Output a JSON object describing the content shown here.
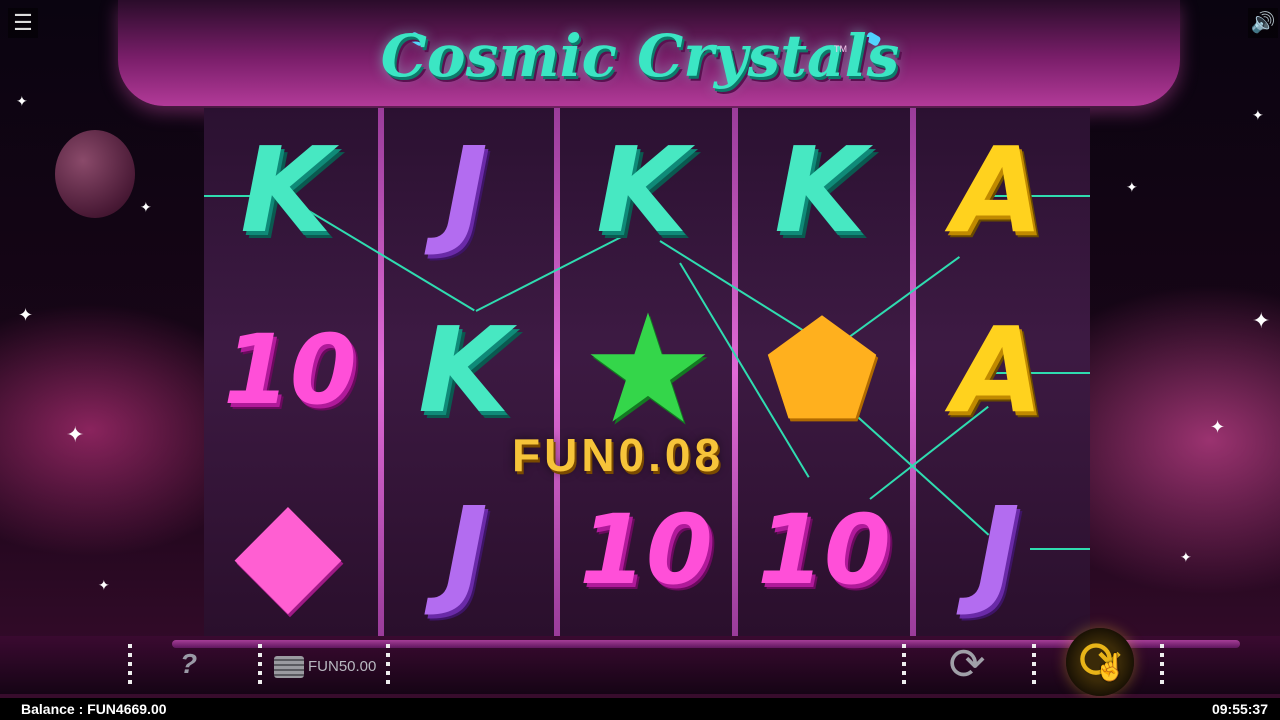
{
  "game": {
    "title": "Cosmic Crystals",
    "trademark": "TM"
  },
  "controls": {
    "menu_icon": "☰",
    "sound_icon": "🔊",
    "help_label": "?",
    "stake_value": "FUN50.00",
    "autoplay_icon": "⟳",
    "spin_icon": "⟳"
  },
  "reels": [
    [
      "K",
      "10",
      "◆"
    ],
    [
      "J",
      "K",
      "J"
    ],
    [
      "K",
      "★",
      "10"
    ],
    [
      "K",
      "⬟",
      "10"
    ],
    [
      "A",
      "A",
      "J"
    ]
  ],
  "win": {
    "amount": "FUN0.08"
  },
  "status_bar": {
    "balance": "Balance : FUN4669.00",
    "time": "09:55:37"
  },
  "colors": {
    "payline": "#2fdcb0",
    "win_text": "#f6c43a",
    "spin_button": "#e8b418"
  }
}
